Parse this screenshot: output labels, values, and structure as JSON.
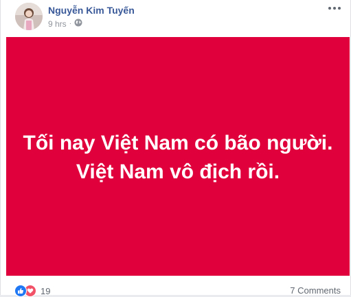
{
  "post": {
    "author": "Nguyễn Kim Tuyến",
    "time": "9 hrs",
    "separator": "·",
    "privacy_icon": "globe-icon",
    "menu_icon": "more-options-icon",
    "background_color": "#e0003c",
    "text_lines": [
      "Tối nay Việt Nam có bão người.",
      "Việt Nam vô địch rồi."
    ]
  },
  "reactions": {
    "icons": [
      "like-icon",
      "love-icon"
    ],
    "count": "19",
    "like_color": "#2078f4",
    "love_color": "#f25268"
  },
  "comments": {
    "label": "7 Comments"
  }
}
